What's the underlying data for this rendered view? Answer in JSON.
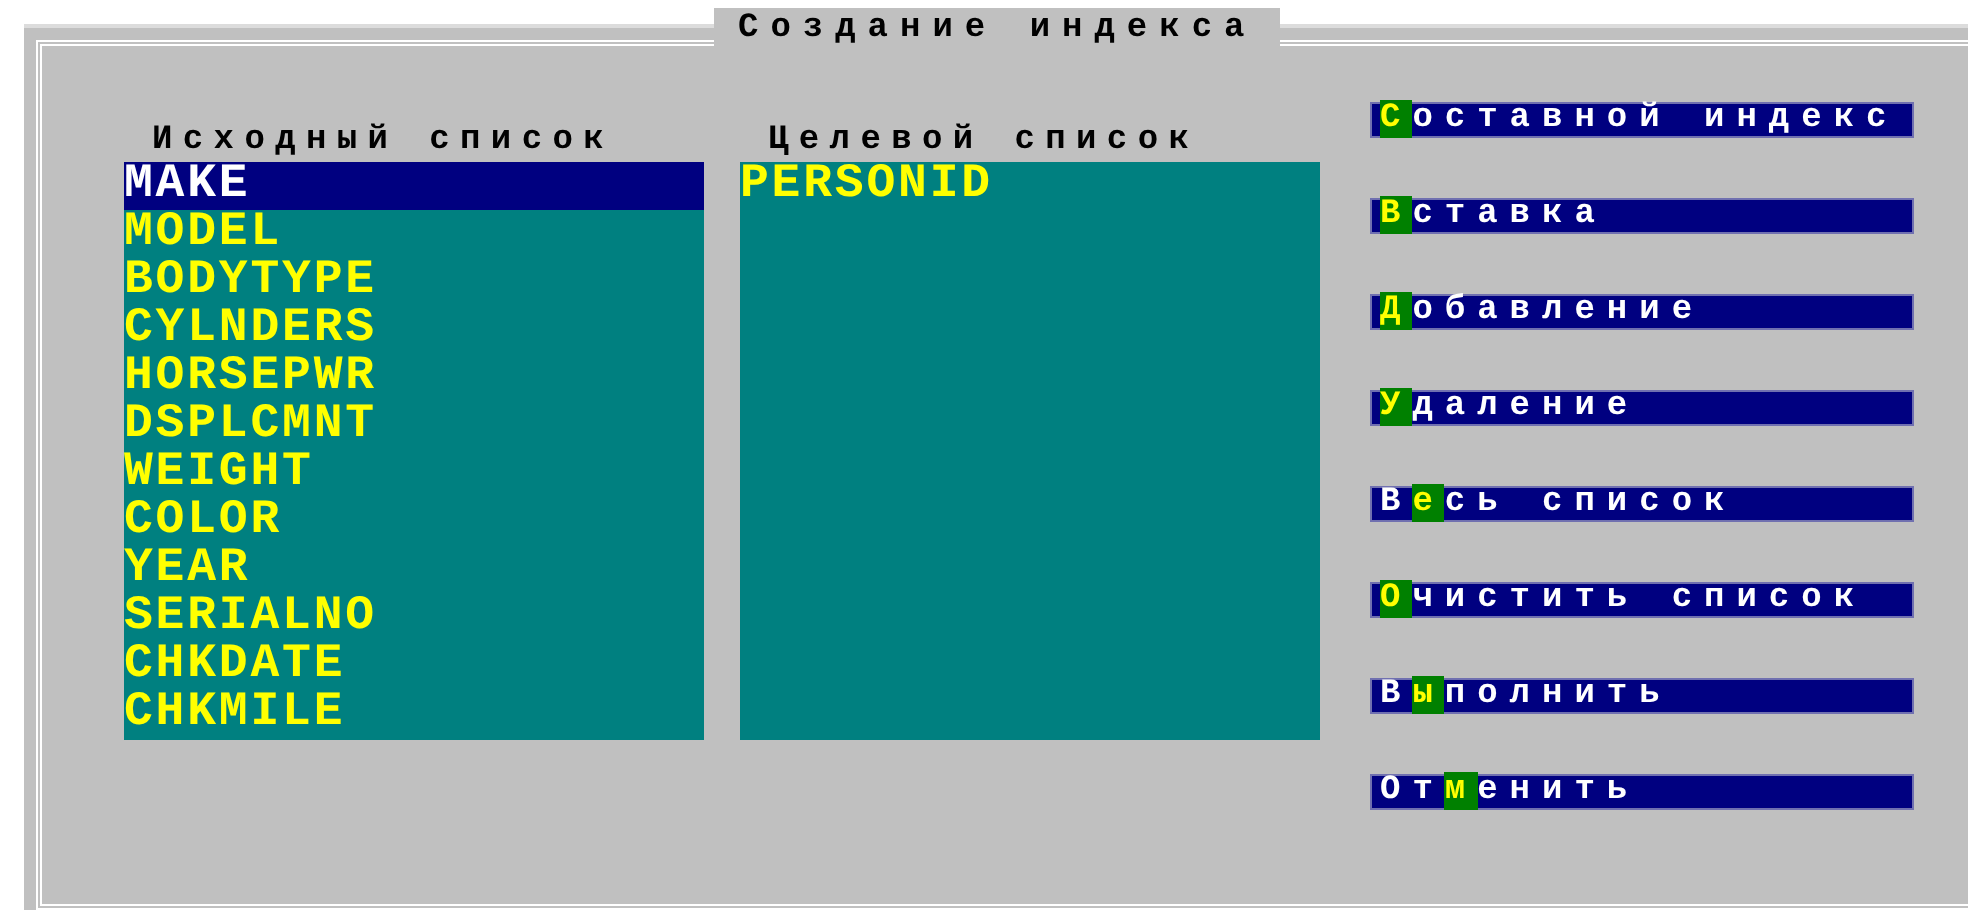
{
  "window": {
    "title": "Создание индекса"
  },
  "source_list": {
    "heading": "Исходный список",
    "items": [
      {
        "label": "MAKE",
        "selected": true
      },
      {
        "label": "MODEL",
        "selected": false
      },
      {
        "label": "BODYTYPE",
        "selected": false
      },
      {
        "label": "CYLNDERS",
        "selected": false
      },
      {
        "label": "HORSEPWR",
        "selected": false
      },
      {
        "label": "DSPLCMNT",
        "selected": false
      },
      {
        "label": "WEIGHT",
        "selected": false
      },
      {
        "label": "COLOR",
        "selected": false
      },
      {
        "label": "YEAR",
        "selected": false
      },
      {
        "label": "SERIALNO",
        "selected": false
      },
      {
        "label": "CHKDATE",
        "selected": false
      },
      {
        "label": "CHKMILE",
        "selected": false
      }
    ]
  },
  "target_list": {
    "heading": "Целевой список",
    "items": [
      {
        "label": "PERSONID",
        "selected": false
      }
    ]
  },
  "buttons": [
    {
      "key": "С",
      "post": "оставной индекс"
    },
    {
      "key": "В",
      "post": "ставка"
    },
    {
      "key": "Д",
      "post": "обавление"
    },
    {
      "key": "У",
      "post": "даление"
    },
    {
      "pre": "В",
      "key": "е",
      "post": "сь список"
    },
    {
      "key": "О",
      "post": "чистить список"
    },
    {
      "pre": "В",
      "key": "ы",
      "post": "полнить"
    },
    {
      "pre": "От",
      "key": "м",
      "post": "енить"
    }
  ]
}
